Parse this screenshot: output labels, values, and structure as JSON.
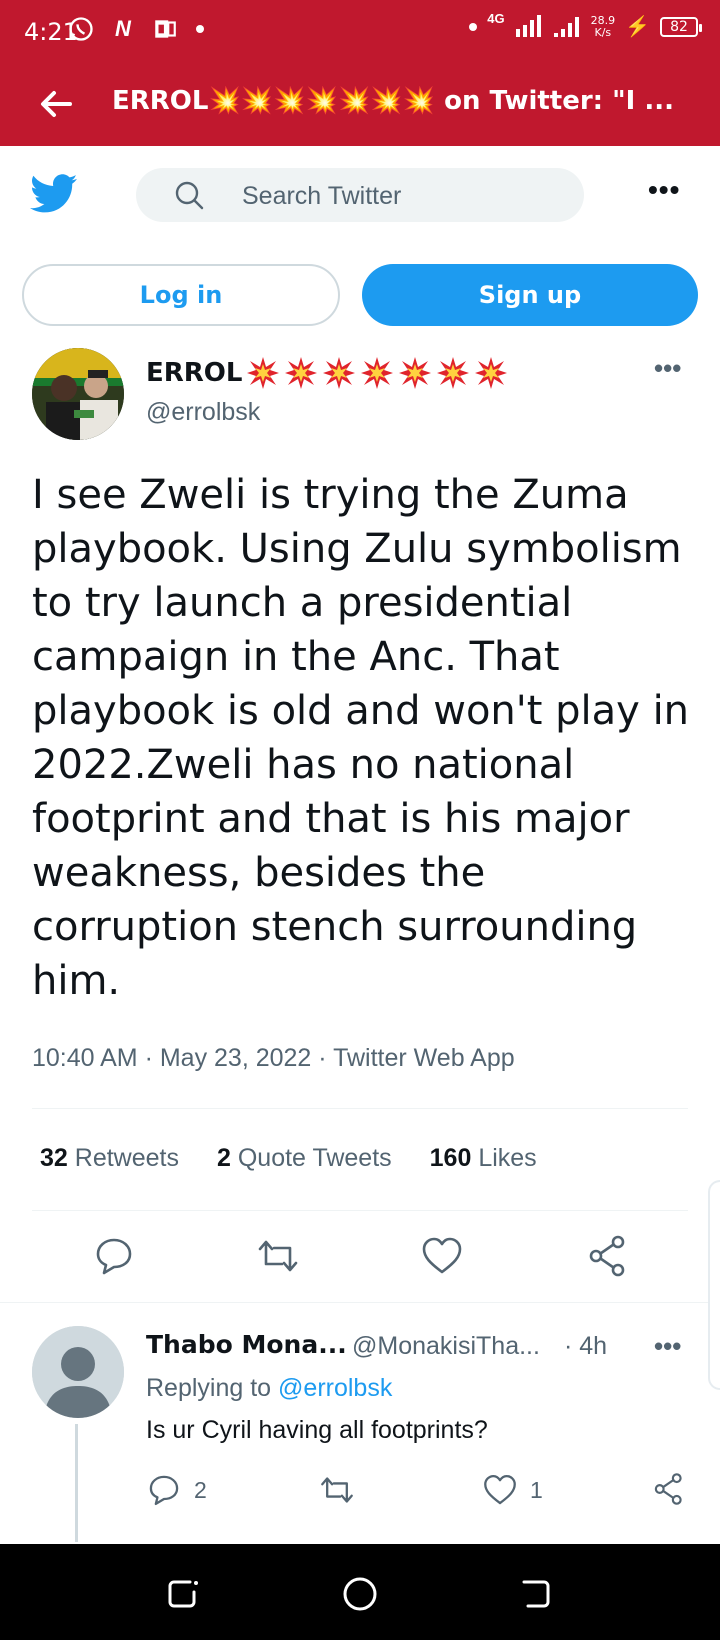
{
  "status_bar": {
    "time": "4:21",
    "network": "4G",
    "speed_value": "28.9",
    "speed_unit": "K/s",
    "battery": "82"
  },
  "title_bar": {
    "title": "ERROL💥💥💥💥💥💥💥 on Twitter: \"I ..."
  },
  "header": {
    "search_placeholder": "Search Twitter"
  },
  "auth": {
    "login_label": "Log in",
    "signup_label": "Sign up"
  },
  "tweet": {
    "author_name": "ERROL",
    "author_handle": "@errolbsk",
    "text": "I see Zweli is trying the Zuma playbook. Using Zulu symbolism to try launch a presidential campaign in the Anc. That playbook is old and won't play in 2022.Zweli has no national footprint and that is his major weakness, besides the corruption stench surrounding him.",
    "timestamp": "10:40 AM · May 23, 2022 · Twitter Web App",
    "retweets_count": "32",
    "retweets_label": "Retweets",
    "quotes_count": "2",
    "quotes_label": "Quote Tweets",
    "likes_count": "160",
    "likes_label": "Likes"
  },
  "reply": {
    "name": "Thabo Mona...",
    "handle": "@MonakisiTha...",
    "time": "· 4h",
    "replying_prefix": "Replying to",
    "replying_to": "@errolbsk",
    "text": "Is ur Cyril having all footprints?",
    "reply_count": "2",
    "like_count": "1"
  },
  "colors": {
    "status_red": "#c0182e",
    "twitter_blue": "#1d9bf0",
    "muted": "#536471"
  }
}
